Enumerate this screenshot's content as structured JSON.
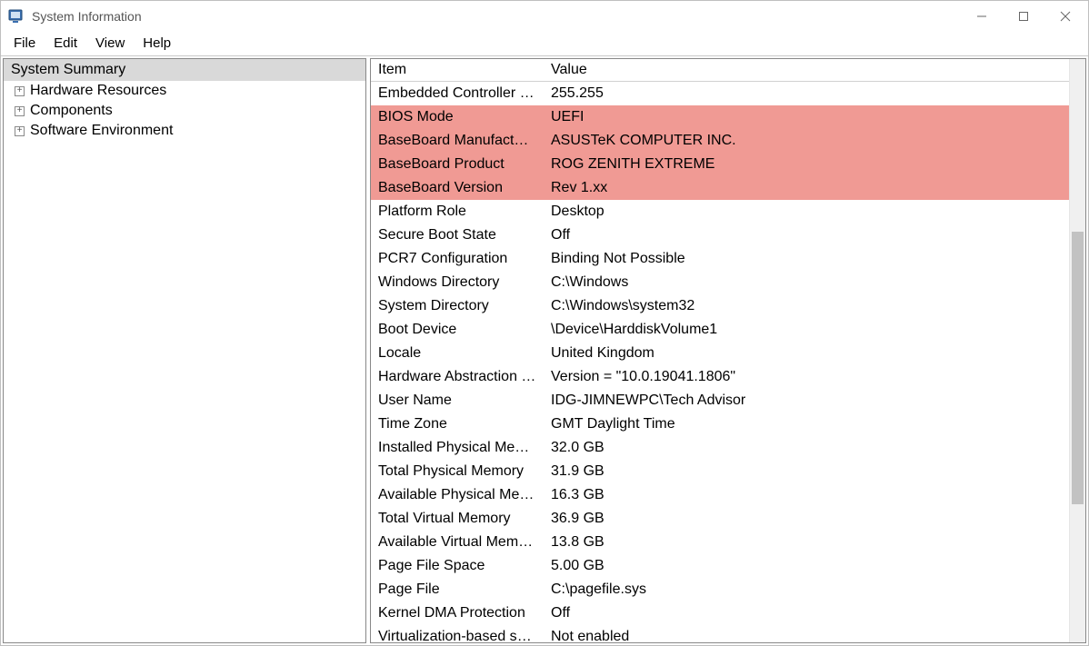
{
  "window": {
    "title": "System Information"
  },
  "menu": {
    "items": [
      "File",
      "Edit",
      "View",
      "Help"
    ]
  },
  "tree": {
    "header": "System Summary",
    "items": [
      {
        "label": "Hardware Resources"
      },
      {
        "label": "Components"
      },
      {
        "label": "Software Environment"
      }
    ]
  },
  "list": {
    "columns": {
      "item": "Item",
      "value": "Value"
    },
    "rows": [
      {
        "item": "Embedded Controller V...",
        "value": "255.255",
        "highlight": false
      },
      {
        "item": "BIOS Mode",
        "value": "UEFI",
        "highlight": true
      },
      {
        "item": "BaseBoard Manufacturer",
        "value": "ASUSTeK COMPUTER INC.",
        "highlight": true
      },
      {
        "item": "BaseBoard Product",
        "value": "ROG ZENITH EXTREME",
        "highlight": true
      },
      {
        "item": "BaseBoard Version",
        "value": "Rev 1.xx",
        "highlight": true
      },
      {
        "item": "Platform Role",
        "value": "Desktop",
        "highlight": false
      },
      {
        "item": "Secure Boot State",
        "value": "Off",
        "highlight": false
      },
      {
        "item": "PCR7 Configuration",
        "value": "Binding Not Possible",
        "highlight": false
      },
      {
        "item": "Windows Directory",
        "value": "C:\\Windows",
        "highlight": false
      },
      {
        "item": "System Directory",
        "value": "C:\\Windows\\system32",
        "highlight": false
      },
      {
        "item": "Boot Device",
        "value": "\\Device\\HarddiskVolume1",
        "highlight": false
      },
      {
        "item": "Locale",
        "value": "United Kingdom",
        "highlight": false
      },
      {
        "item": "Hardware Abstraction L...",
        "value": "Version = \"10.0.19041.1806\"",
        "highlight": false
      },
      {
        "item": "User Name",
        "value": "IDG-JIMNEWPC\\Tech Advisor",
        "highlight": false
      },
      {
        "item": "Time Zone",
        "value": "GMT Daylight Time",
        "highlight": false
      },
      {
        "item": "Installed Physical Mem...",
        "value": "32.0 GB",
        "highlight": false
      },
      {
        "item": "Total Physical Memory",
        "value": "31.9 GB",
        "highlight": false
      },
      {
        "item": "Available Physical Mem...",
        "value": "16.3 GB",
        "highlight": false
      },
      {
        "item": "Total Virtual Memory",
        "value": "36.9 GB",
        "highlight": false
      },
      {
        "item": "Available Virtual Memory",
        "value": "13.8 GB",
        "highlight": false
      },
      {
        "item": "Page File Space",
        "value": "5.00 GB",
        "highlight": false
      },
      {
        "item": "Page File",
        "value": "C:\\pagefile.sys",
        "highlight": false
      },
      {
        "item": "Kernel DMA Protection",
        "value": "Off",
        "highlight": false
      },
      {
        "item": "Virtualization-based se...",
        "value": "Not enabled",
        "highlight": false
      }
    ]
  }
}
